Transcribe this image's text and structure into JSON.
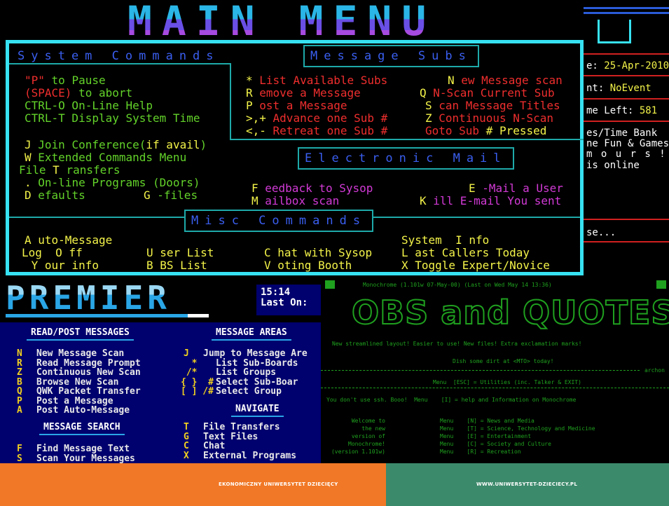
{
  "title": "MAIN MENU",
  "system_commands": {
    "header": "System Commands",
    "lines": [
      {
        "key": "\"P\"",
        "text": " to Pause"
      },
      {
        "key": "(SPACE)",
        "text": " to abort"
      },
      {
        "key": "",
        "text": "CTRL-O On-Line Help"
      },
      {
        "key": "",
        "text": "CTRL-T Display System Time"
      }
    ],
    "items": [
      {
        "key": "J",
        "text": " Join Conference(",
        "extra": "if avail",
        "end": ")"
      },
      {
        "key": "W",
        "text": " Extended Commands Menu"
      },
      {
        "key": "File ",
        "text": "T",
        "end": " ransfers"
      },
      {
        "key": ".",
        "text": " On-line Programs (Doors)"
      },
      {
        "key": "D",
        "text": " efaults",
        "key2": "G",
        "text2": " -files"
      }
    ]
  },
  "message_subs": {
    "header": "Message Subs",
    "rows": [
      {
        "k1": "*",
        "t1": " List Available Subs",
        "k2": "N",
        "t2": " ew Message scan"
      },
      {
        "k1": "R",
        "t1": " emove a Message",
        "k2": "Q",
        "t2": " N-Scan Current Sub"
      },
      {
        "k1": "P",
        "t1": " ost a Message",
        "k2": "S",
        "t2": " can Message Titles"
      },
      {
        "k1": ">,+",
        "t1": " Advance one Sub #",
        "k2": "Z",
        "t2": " Continuous N-Scan"
      },
      {
        "k1": "<,-",
        "t1": " Retreat one Sub #",
        "k2": "Goto Sub",
        "t2": " # Pressed"
      }
    ]
  },
  "electronic_mail": {
    "header": "Electronic Mail",
    "rows": [
      {
        "k1": "F",
        "t1": " eedback to Sysop",
        "k2": "E",
        "t2": " -Mail a User"
      },
      {
        "k1": "M",
        "t1": " ailbox scan",
        "k2": "K",
        "t2": " ill E-mail You sent"
      }
    ]
  },
  "misc_commands": {
    "header": "Misc Commands",
    "rows": [
      {
        "a": "A uto-Message",
        "b": "",
        "c": "",
        "d": "System  I nfo"
      },
      {
        "a": "Log  O ff",
        "b": "U ser List",
        "c": "C hat with Sysop",
        "d": "L ast Callers Today"
      },
      {
        "a": " Y our info",
        "b": "B BS List",
        "c": "V oting Booth",
        "d": "X Toggle Expert/Novice"
      }
    ]
  },
  "right_panel": {
    "date_label": "e: ",
    "date_value": "25-Apr-2010",
    "event_label": "nt: ",
    "event_value": "NoEvent",
    "time_label": "me Left: ",
    "time_value": "581",
    "lines": [
      "es/Time Bank",
      "ne Fun & Games",
      "m o u r s !!",
      "is online"
    ],
    "pause": "se..."
  },
  "premier": {
    "logo": "PREMIER",
    "time": "15:14",
    "last_on": "Last On:",
    "read_post": {
      "header": "READ/POST MESSAGES",
      "items": [
        {
          "key": "N",
          "text": "New Message Scan"
        },
        {
          "key": "R",
          "text": "Read Message Prompt"
        },
        {
          "key": "Z",
          "text": "Continuous New Scan"
        },
        {
          "key": "B",
          "text": "Browse New Scan"
        },
        {
          "key": "Q",
          "text": "QWK Packet Transfer"
        },
        {
          "key": "P",
          "text": "Post a Message"
        },
        {
          "key": "A",
          "text": "Post Auto-Message"
        }
      ]
    },
    "message_search": {
      "header": "MESSAGE SEARCH",
      "items": [
        {
          "key": "F",
          "text": "Find Message Text"
        },
        {
          "key": "S",
          "text": "Scan Your Messages"
        }
      ]
    },
    "message_areas": {
      "header": "MESSAGE AREAS",
      "items": [
        {
          "key": "J",
          "text": "Jump to Message Are"
        },
        {
          "key": "  *",
          "text": "List Sub-Boards"
        },
        {
          "key": " /*",
          "text": "List Groups"
        },
        {
          "key": "{ }  #",
          "text": "Select Sub-Boar"
        },
        {
          "key": "[ ] /#",
          "text": "Select Group"
        }
      ]
    },
    "navigate": {
      "header": "NAVIGATE",
      "items": [
        {
          "key": "T",
          "text": "File Transfers"
        },
        {
          "key": "G",
          "text": "Text Files"
        },
        {
          "key": "C",
          "text": "Chat"
        },
        {
          "key": "X",
          "text": "External Programs"
        }
      ]
    }
  },
  "monochrome": {
    "header": "Monochrome (1.101w 07-May-00) (Last on Wed May 14 13:36)",
    "logo": "OBS and QUOTES",
    "tagline": "New streamlined layout! Easier to use! New files! Extra exclamation marks!",
    "dirt": "Dish some dirt at <MTO> today!",
    "archon": "archon",
    "menu_line": "Menu  [ESC] = Utilities (inc. Talker & EXIT)",
    "ssh_line": "You don't use ssh. Booo!  Menu    [I] = help and Information on Monochrome",
    "welcome": [
      "Welcome to",
      "the new",
      "version of",
      "Monochrome!",
      "(version 1.101w)"
    ],
    "menu_items": [
      "Menu    [N] = News and Media",
      "Menu    [T] = Science, Technology and Medicine",
      "Menu    [E] = Entertainment",
      "Menu    [C] = Society and Culture",
      "Menu    [R] = Recreation"
    ]
  },
  "footer": {
    "left": "EKONOMICZNY UNIWERSYTET DZIECIĘCY",
    "right": "WWW.UNIWERSYTET-DZIECIECY.PL"
  }
}
